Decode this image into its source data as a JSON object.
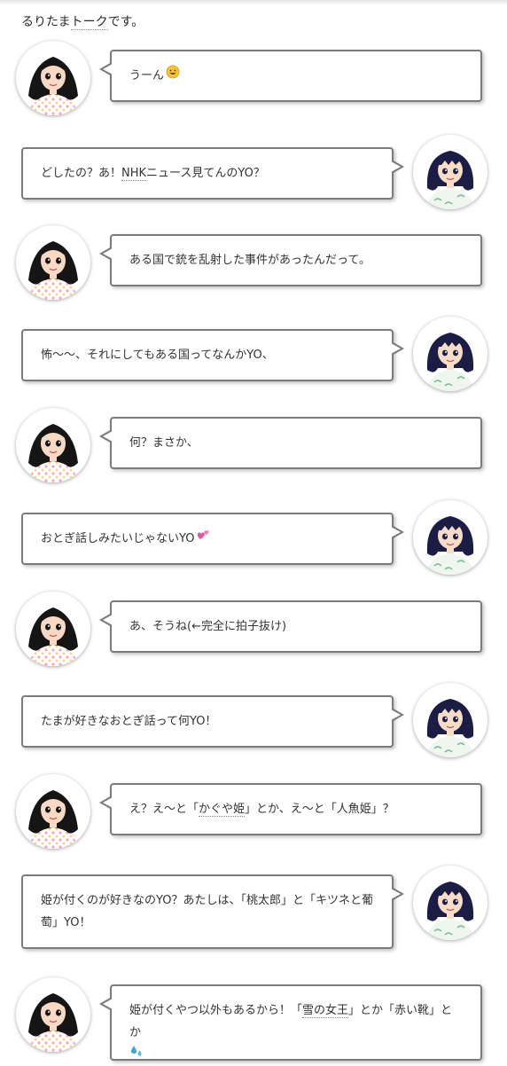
{
  "intro": {
    "prefix": "るりたま",
    "link": "トーク",
    "suffix": "です。"
  },
  "avatars": {
    "left": "ruri-avatar",
    "right": "tama-avatar"
  },
  "messages": [
    {
      "side": "left",
      "text": "うーん",
      "emoji": "grinning-face"
    },
    {
      "side": "right",
      "text_a": "どしたの？あ！",
      "link": "NHK",
      "text_b": "ニュース見てんのYO？"
    },
    {
      "side": "left",
      "text": "ある国で銃を乱射した事件があったんだって。"
    },
    {
      "side": "right",
      "text": "怖〜〜、それにしてもある国ってなんかYO、"
    },
    {
      "side": "left",
      "text": "何？まさか、"
    },
    {
      "side": "right",
      "text": "おとぎ話しみたいじゃないYO",
      "emoji": "two-hearts"
    },
    {
      "side": "left",
      "text": "あ、そうね(←完全に拍子抜け)"
    },
    {
      "side": "right",
      "text": "たまが好きなおとぎ話って何YO！"
    },
    {
      "side": "left",
      "text_a": "え？え〜と「",
      "link": "かぐや姫",
      "text_b": "」とか、え〜と「人魚姫」？"
    },
    {
      "side": "right",
      "text": "姫が付くのが好きなのYO？あたしは、「桃太郎」と「キツネと葡萄」YO！"
    },
    {
      "side": "left",
      "text_a": "姫が付くやつ以外もあるから！「",
      "link": "雪の女王",
      "text_b": "」とか「赤い靴」とか",
      "emoji": "sweat-droplets"
    }
  ]
}
